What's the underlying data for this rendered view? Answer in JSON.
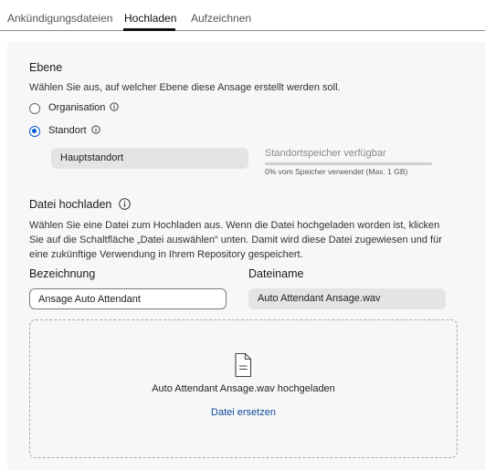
{
  "tabs": [
    {
      "label": "Ankündigungsdateien",
      "active": false
    },
    {
      "label": "Hochladen",
      "active": true
    },
    {
      "label": "Aufzeichnen",
      "active": false
    }
  ],
  "level": {
    "heading": "Ebene",
    "description": "Wählen Sie aus, auf welcher Ebene diese Ansage erstellt werden soll.",
    "options": [
      {
        "label": "Organisation",
        "selected": false,
        "icon": "info-icon"
      },
      {
        "label": "Standort",
        "selected": true,
        "icon": "info-icon"
      }
    ],
    "location_select_value": "Hauptstandort"
  },
  "storage": {
    "label": "Standortspeicher verfügbar",
    "usage_text": "0% vom Speicher verwendet (Max. 1 GB)",
    "used_percent": 0
  },
  "upload": {
    "heading": "Datei hochladen",
    "description_lines": [
      "Wählen Sie eine Datei zum Hochladen aus. Wenn die Datei hochgeladen worden ist, klicken",
      "Sie auf die Schaltfläche „Datei auswählen“ unten. Damit wird diese Datei zugewiesen und für",
      "eine zukünftige Verwendung in Ihrem Repository gespeichert."
    ],
    "name_label": "Bezeichnung",
    "name_value": "Ansage Auto Attendant",
    "filename_label": "Dateiname",
    "filename_value": "Auto Attendant Ansage.wav",
    "uploaded_text": "Auto Attendant Ansage.wav hochgeladen",
    "replace_link": "Datei ersetzen"
  },
  "colors": {
    "accent": "#0a5bd3",
    "link": "#0d4a9a",
    "panel_bg": "#f7f7f7",
    "field_bg": "#e4e4e4"
  }
}
